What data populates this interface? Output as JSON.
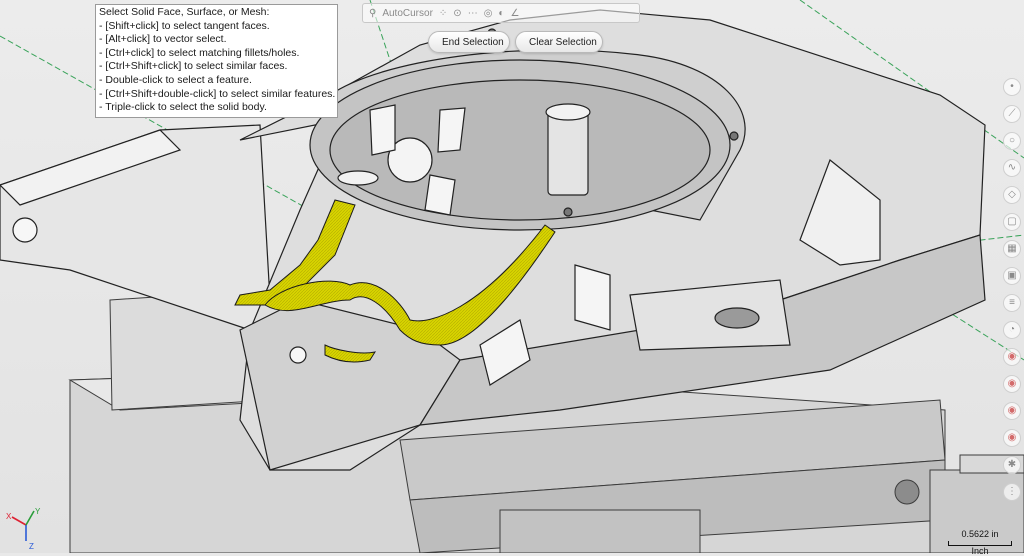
{
  "tooltip": {
    "lines": [
      "Select Solid Face, Surface, or Mesh:",
      "- [Shift+click] to select tangent faces.",
      "- [Alt+click] to vector select.",
      "- [Ctrl+click] to select matching fillets/holes.",
      "- [Ctrl+Shift+click] to select similar faces.",
      "- Double-click to select a feature.",
      "- [Ctrl+Shift+double-click] to select similar features.",
      "- Triple-click to select the solid body."
    ]
  },
  "toolbar": {
    "autocursor_label": "AutoCursor",
    "end_selection_label": "End Selection",
    "clear_selection_label": "Clear Selection"
  },
  "scale": {
    "value": "0.5622 in",
    "unit": "Inch"
  },
  "axes": {
    "x": "X",
    "y": "Y",
    "z": "Z"
  },
  "colors": {
    "selection_highlight": "#d8d400",
    "background": "#e9e9e9",
    "construction_line": "#3aa35a"
  },
  "icons": {
    "end_selection": "check-circle-icon",
    "clear_selection": "no-entry-icon"
  }
}
